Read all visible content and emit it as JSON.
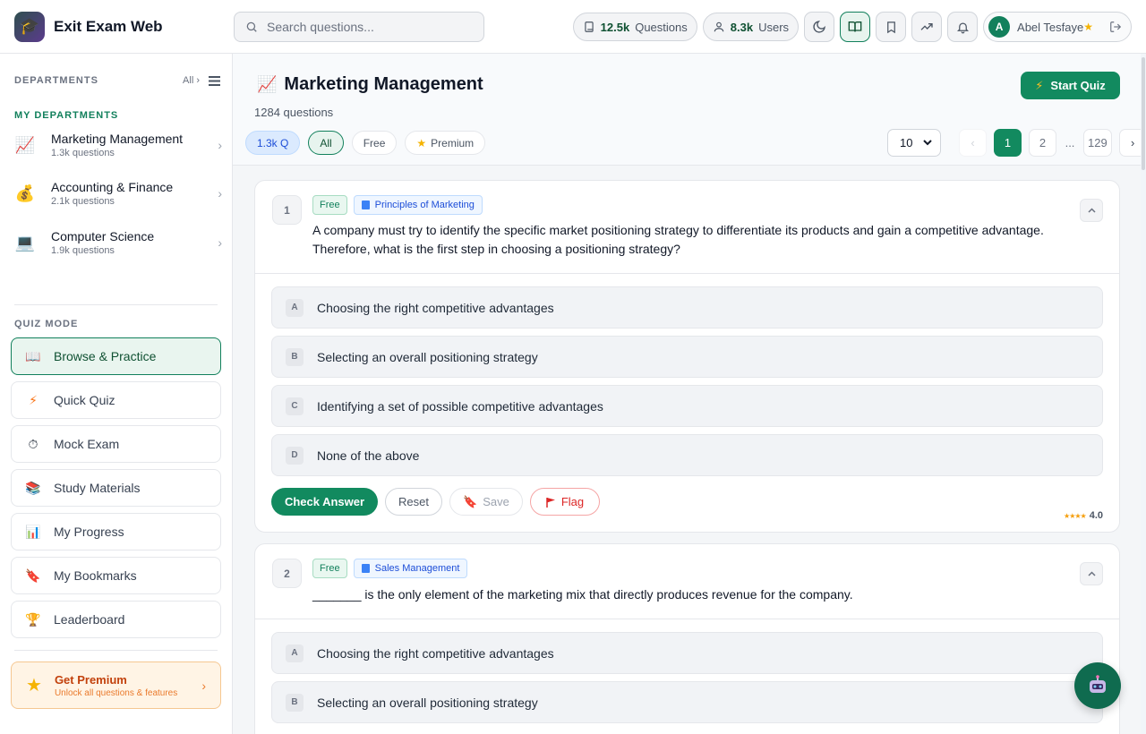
{
  "app": {
    "title": "Exit Exam Web"
  },
  "search": {
    "placeholder": "Search questions..."
  },
  "stats": {
    "questions_value": "12.5k",
    "questions_label": "Questions",
    "users_value": "8.3k",
    "users_label": "Users"
  },
  "user": {
    "initial": "A",
    "name": "Abel Tesfaye"
  },
  "sidebar": {
    "departments_label": "DEPARTMENTS",
    "all_label": "All ›",
    "my_departments_label": "MY DEPARTMENTS",
    "departments": [
      {
        "name": "Marketing Management",
        "count": "1.3k questions",
        "icon": "chart-icon"
      },
      {
        "name": "Accounting & Finance",
        "count": "2.1k questions",
        "icon": "money-bag-icon"
      },
      {
        "name": "Computer Science",
        "count": "1.9k questions",
        "icon": "computer-icon"
      }
    ],
    "quiz_mode_label": "QUIZ MODE",
    "modes": [
      {
        "label": "Browse & Practice",
        "icon": "book-icon",
        "active": true
      },
      {
        "label": "Quick Quiz",
        "icon": "lightning-icon"
      },
      {
        "label": "Mock Exam",
        "icon": "stopwatch-icon"
      },
      {
        "label": "Study Materials",
        "icon": "books-icon"
      },
      {
        "label": "My Progress",
        "icon": "bar-chart-icon"
      },
      {
        "label": "My Bookmarks",
        "icon": "bookmark-icon"
      },
      {
        "label": "Leaderboard",
        "icon": "trophy-icon"
      }
    ],
    "premium": {
      "title": "Get Premium",
      "subtitle": "Unlock all questions & features"
    }
  },
  "main": {
    "title": "Marketing Management",
    "count": "1284 questions",
    "start_quiz": "Start Quiz",
    "filters": {
      "count": "1.3k Q",
      "all": "All",
      "free": "Free",
      "premium": "Premium"
    },
    "pager": {
      "per_page": "10",
      "pages": [
        "1",
        "2",
        "129"
      ],
      "ellipsis": "...",
      "current": "1"
    }
  },
  "questions": [
    {
      "number": "1",
      "tag": "Free",
      "topic": "Principles of Marketing",
      "text": "A company must try to identify the specific market positioning strategy to differentiate its products and gain a competitive advantage. Therefore, what is the first step in choosing a positioning strategy?",
      "options": [
        {
          "letter": "A",
          "text": "Choosing the right competitive advantages"
        },
        {
          "letter": "B",
          "text": "Selecting an overall positioning strategy"
        },
        {
          "letter": "C",
          "text": "Identifying a set of possible competitive advantages"
        },
        {
          "letter": "D",
          "text": "None of the above"
        }
      ],
      "actions": {
        "check": "Check Answer",
        "reset": "Reset",
        "save": "Save",
        "flag": "Flag"
      },
      "rating": "4.0",
      "stars": "★★★★"
    },
    {
      "number": "2",
      "tag": "Free",
      "topic": "Sales Management",
      "text": "_______ is the only element of the marketing mix that directly produces revenue for the company.",
      "options": [
        {
          "letter": "A",
          "text": "Choosing the right competitive advantages"
        },
        {
          "letter": "B",
          "text": "Selecting an overall positioning strategy"
        }
      ]
    }
  ],
  "colors": {
    "accent": "#128a5f",
    "premium": "#c2410c",
    "topic": "#1d4ed8",
    "flag": "#dc2626"
  }
}
